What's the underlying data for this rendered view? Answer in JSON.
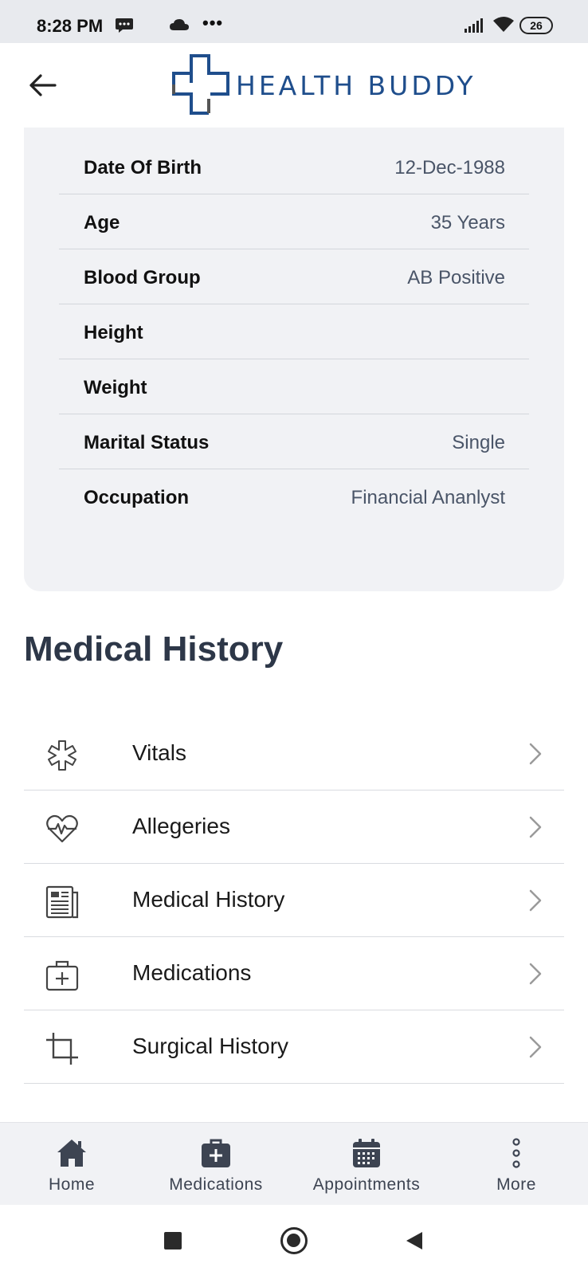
{
  "status_bar": {
    "time": "8:28 PM",
    "overflow": "•••",
    "battery": "26",
    "icons": [
      "message-icon",
      "cloud-icon",
      "signal-icon",
      "wifi-icon",
      "battery-icon"
    ]
  },
  "header": {
    "back_icon": "arrow-left-icon",
    "logo_text": "HEALTH BUDDY",
    "logo_color": "#1f4e8c"
  },
  "profile": {
    "rows": [
      {
        "label": "Date Of Birth",
        "value": "12-Dec-1988"
      },
      {
        "label": "Age",
        "value": "35 Years"
      },
      {
        "label": "Blood Group",
        "value": "AB Positive"
      },
      {
        "label": "Height",
        "value": ""
      },
      {
        "label": "Weight",
        "value": ""
      },
      {
        "label": "Marital Status",
        "value": "Single"
      },
      {
        "label": "Occupation",
        "value": "Financial Ananlyst"
      }
    ]
  },
  "medical_history": {
    "title": "Medical History",
    "items": [
      {
        "label": "Vitals",
        "icon": "asterisk-icon"
      },
      {
        "label": "Allegeries",
        "icon": "heartbeat-icon"
      },
      {
        "label": "Medical History",
        "icon": "document-icon"
      },
      {
        "label": "Medications",
        "icon": "medical-kit-icon"
      },
      {
        "label": "Surgical History",
        "icon": "crop-icon"
      }
    ]
  },
  "bottom_nav": {
    "items": [
      {
        "label": "Home",
        "icon": "home-icon"
      },
      {
        "label": "Medications",
        "icon": "medical-bag-icon"
      },
      {
        "label": "Appointments",
        "icon": "calendar-icon"
      },
      {
        "label": "More",
        "icon": "more-vertical-icon"
      }
    ]
  },
  "colors": {
    "card_bg": "#f1f2f5",
    "title": "#2d3748",
    "value_text": "#4a5568",
    "nav_icon": "#3d4452"
  }
}
